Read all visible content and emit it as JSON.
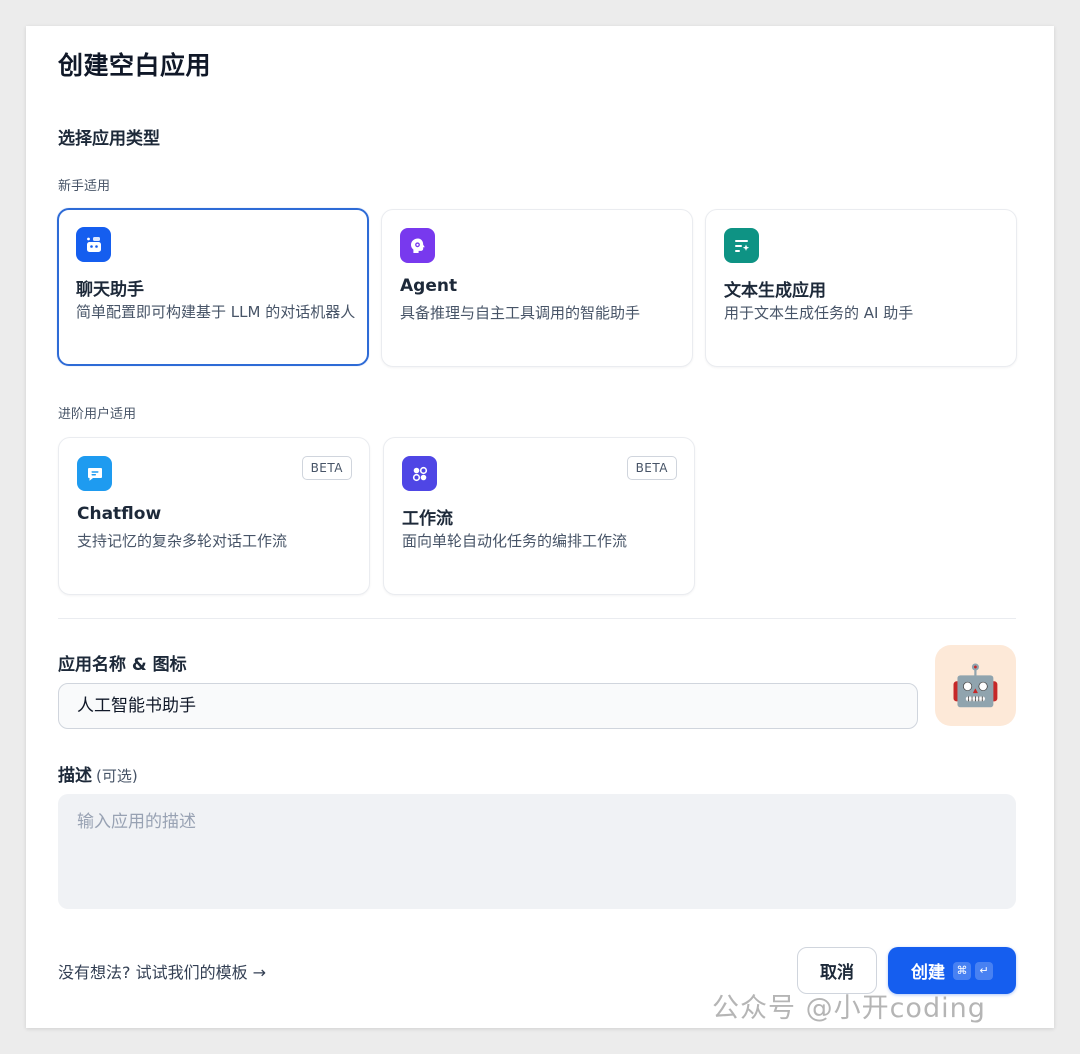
{
  "dialog": {
    "title": "创建空白应用",
    "section_title": "选择应用类型"
  },
  "groups": {
    "beginner_label": "新手适用",
    "advanced_label": "进阶用户适用"
  },
  "cards": [
    {
      "title": "聊天助手",
      "desc": "简单配置即可构建基于 LLM 的对话机器人",
      "icon": "chat-bot-icon",
      "color": "#155eef",
      "selected": true
    },
    {
      "title": "Agent",
      "desc": "具备推理与自主工具调用的智能助手",
      "icon": "agent-brain-icon",
      "color": "#7839ee",
      "selected": false
    },
    {
      "title": "文本生成应用",
      "desc": "用于文本生成任务的 AI 助手",
      "icon": "text-generation-icon",
      "color": "#0e9384",
      "selected": false
    },
    {
      "title": "Chatflow",
      "desc": "支持记忆的复杂多轮对话工作流",
      "icon": "chatflow-icon",
      "color": "#1e9bf0",
      "badge": "BETA",
      "selected": false
    },
    {
      "title": "工作流",
      "desc": "面向单轮自动化任务的编排工作流",
      "icon": "workflow-icon",
      "color": "#4f46e5",
      "badge": "BETA",
      "selected": false
    }
  ],
  "name_field": {
    "label": "应用名称 & 图标",
    "value": "人工智能书助手",
    "avatar_emoji": "🤖",
    "avatar_bg": "#fde9d8"
  },
  "description_field": {
    "label": "描述",
    "optional": "(可选)",
    "placeholder": "输入应用的描述"
  },
  "footer": {
    "template_link": "没有想法? 试试我们的模板 →",
    "cancel_label": "取消",
    "create_label": "创建",
    "shortcut_cmd": "⌘",
    "shortcut_enter": "↵"
  },
  "watermark": "公众号 @小开coding"
}
